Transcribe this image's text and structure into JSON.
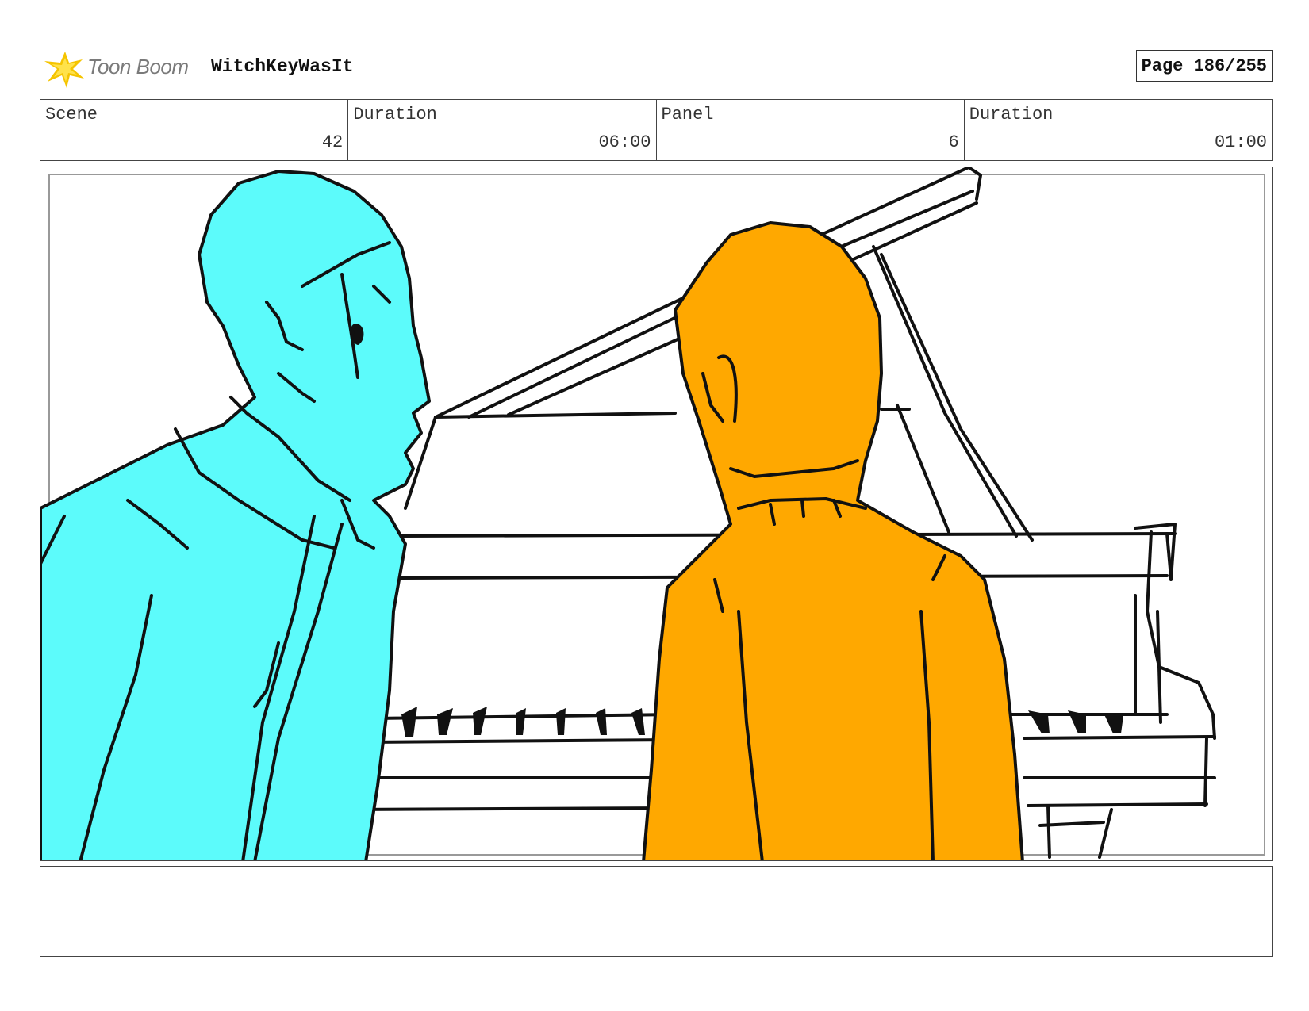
{
  "header": {
    "brand_name": "Toon Boom",
    "project_title": "WitchKeyWasIt",
    "page_label": "Page 186/255"
  },
  "info": {
    "scene_label": "Scene",
    "scene_value": "42",
    "scene_duration_label": "Duration",
    "scene_duration_value": "06:00",
    "panel_label": "Panel",
    "panel_value": "6",
    "panel_duration_label": "Duration",
    "panel_duration_value": "01:00"
  },
  "notes": {
    "text": ""
  },
  "colors": {
    "left_character": "#5cfbfb",
    "right_character": "#ffa800",
    "logo_star": "#f5c400",
    "ink": "#111111"
  },
  "icons": {
    "logo": "toon-boom-star-icon"
  }
}
